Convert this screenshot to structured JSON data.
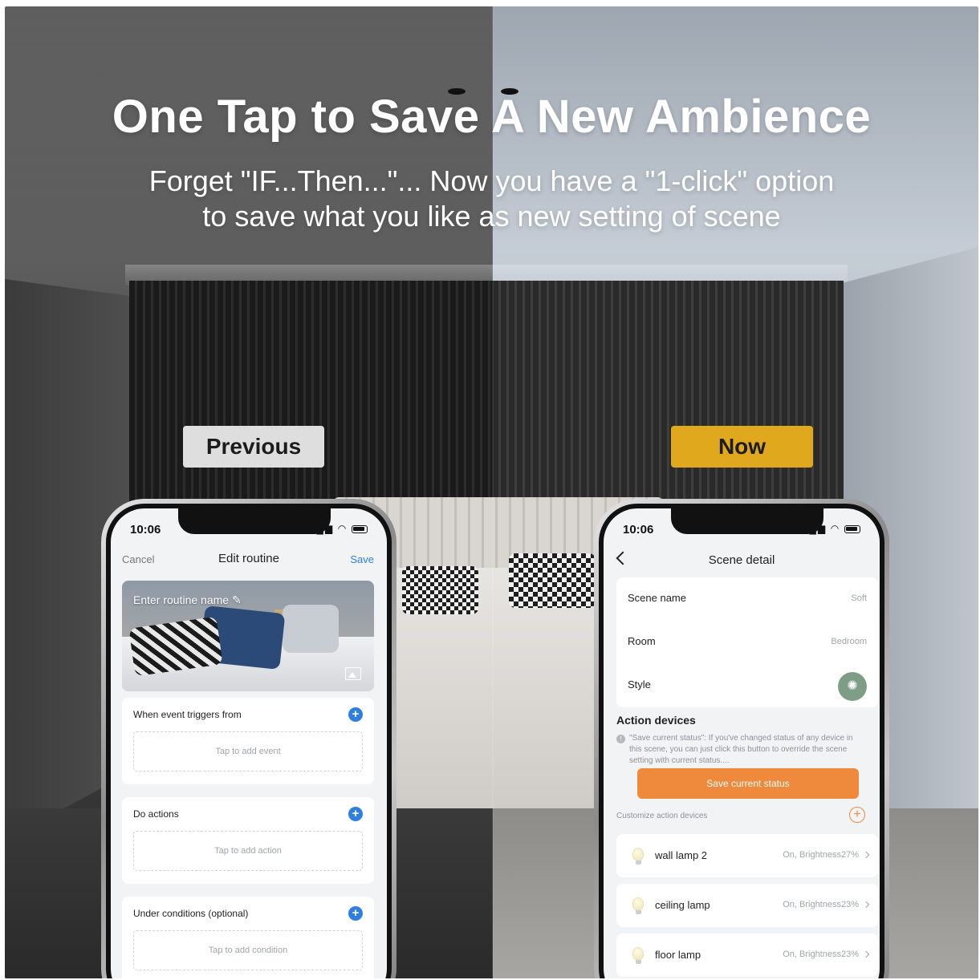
{
  "headline": {
    "title": "One Tap to Save A New Ambience",
    "subtitle_line1": "Forget \"IF...Then...\"... Now you have a \"1-click\" option",
    "subtitle_line2": "to save what you like as new setting of scene"
  },
  "tags": {
    "previous": "Previous",
    "now": "Now"
  },
  "colors": {
    "now_tag": "#e0a81c",
    "previous_tag": "#dedede",
    "accent_blue": "#2f7fe0",
    "accent_orange": "#ef8a3c"
  },
  "phone_left": {
    "time": "10:06",
    "nav": {
      "cancel": "Cancel",
      "title": "Edit routine",
      "save": "Save"
    },
    "hero_label": "Enter routine name",
    "sections": [
      {
        "title": "When event triggers from",
        "placeholder": "Tap to add event"
      },
      {
        "title": "Do actions",
        "placeholder": "Tap to add action"
      },
      {
        "title": "Under conditions (optional)",
        "placeholder": "Tap to add condition"
      }
    ]
  },
  "phone_right": {
    "time": "10:06",
    "title": "Scene detail",
    "rows": [
      {
        "label": "Scene name",
        "value": "Soft"
      },
      {
        "label": "Room",
        "value": "Bedroom"
      },
      {
        "label": "Style",
        "value": ""
      }
    ],
    "action_title": "Action devices",
    "note": "\"Save current status\": If you've changed status of any device in this scene, you can just click this button to override the scene setting with current status....",
    "save_button": "Save current status",
    "customize_label": "Customize action devices",
    "devices": [
      {
        "name": "wall lamp 2",
        "status": "On, Brightness27%"
      },
      {
        "name": "ceiling lamp",
        "status": "On, Brightness23%"
      },
      {
        "name": "floor lamp",
        "status": "On, Brightness23%"
      }
    ]
  }
}
